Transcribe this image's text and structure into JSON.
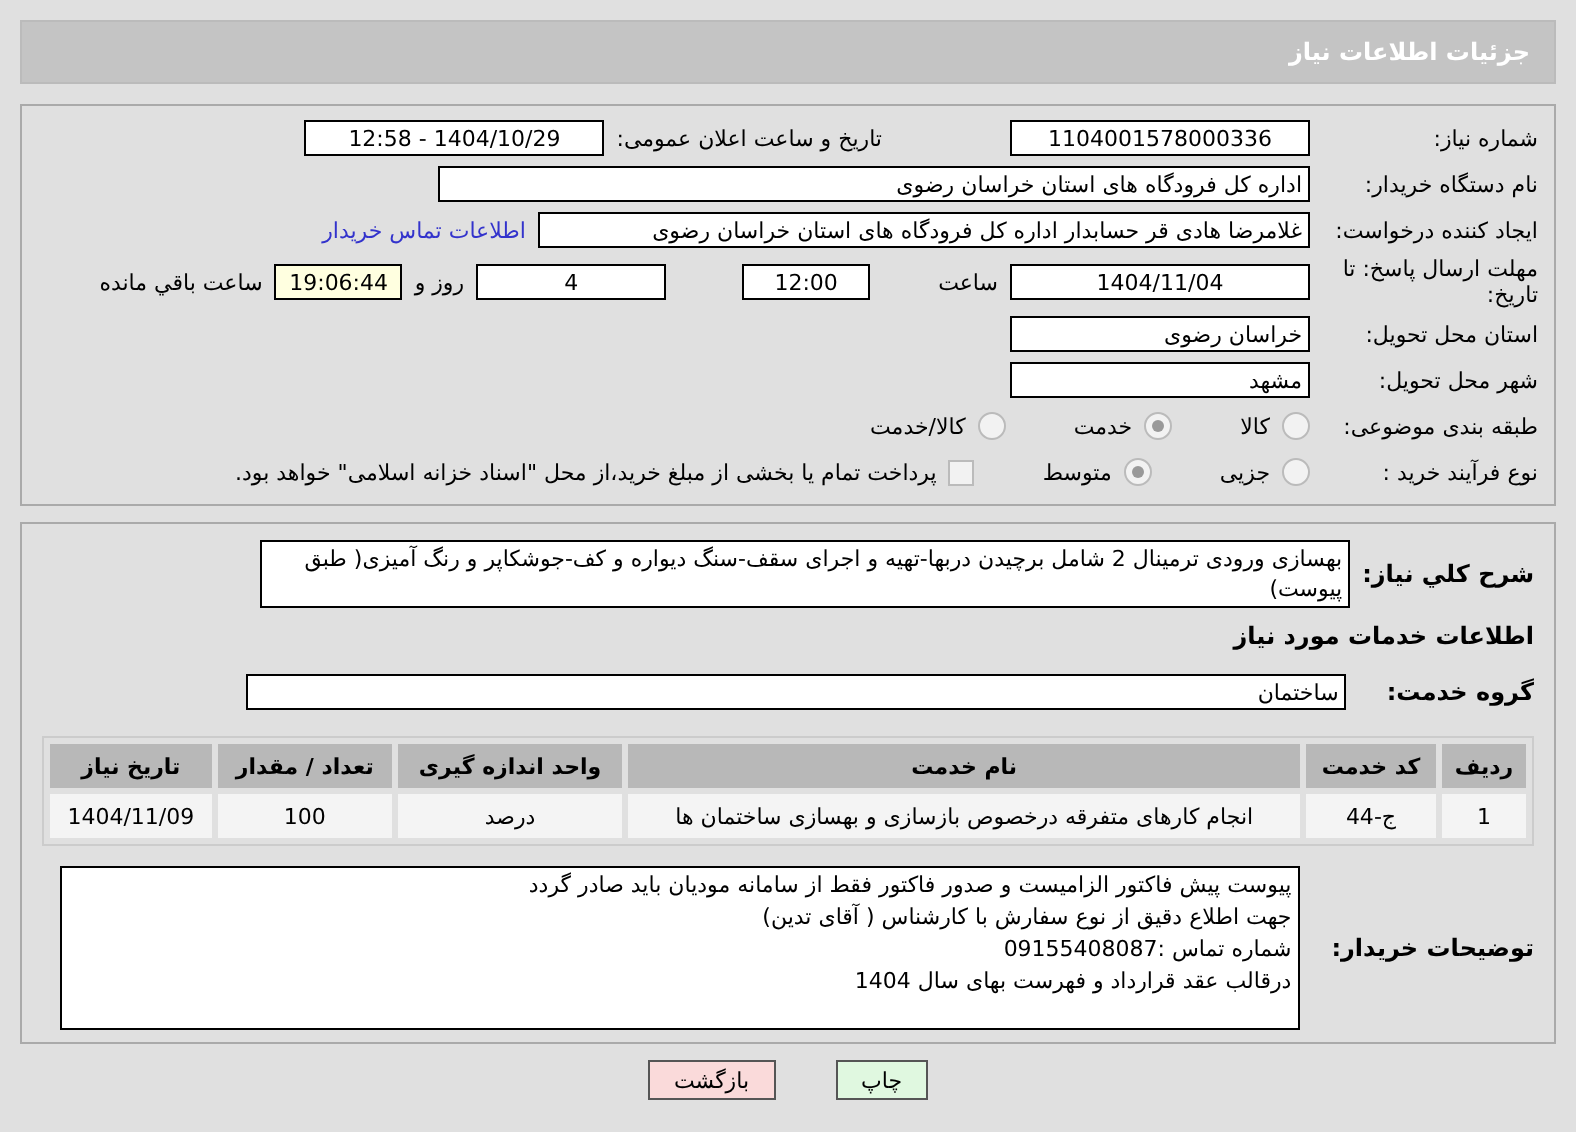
{
  "header": {
    "title": "جزئیات اطلاعات نیاز"
  },
  "need_number": {
    "label": "شماره نیاز:",
    "value": "1104001578000336"
  },
  "announce": {
    "label": "تاریخ و ساعت اعلان عمومی:",
    "value": "1404/10/29 - 12:58"
  },
  "buyer_org": {
    "label": "نام دستگاه خریدار:",
    "value": "اداره کل فرودگاه های استان خراسان رضوی"
  },
  "requester": {
    "label": "ایجاد کننده درخواست:",
    "value": "غلامرضا هادی قر حسابدار اداره کل فرودگاه های استان خراسان رضوی",
    "link": "اطلاعات تماس خریدار"
  },
  "deadline": {
    "label": "مهلت ارسال پاسخ: تا تاریخ:",
    "date": "1404/11/04",
    "time_label": "ساعت",
    "time": "12:00",
    "days": "4",
    "days_label": "روز و",
    "remaining": "19:06:44",
    "remaining_label": "ساعت باقي مانده"
  },
  "province": {
    "label": "استان محل تحویل:",
    "value": "خراسان رضوی"
  },
  "city": {
    "label": "شهر محل تحویل:",
    "value": "مشهد"
  },
  "category": {
    "label": "طبقه بندی موضوعی:",
    "options": [
      {
        "label": "کالا",
        "selected": false
      },
      {
        "label": "خدمت",
        "selected": true
      },
      {
        "label": "کالا/خدمت",
        "selected": false
      }
    ]
  },
  "purchase_type": {
    "label": "نوع فرآیند خرید :",
    "options": [
      {
        "label": "جزیی",
        "selected": false
      },
      {
        "label": "متوسط",
        "selected": true
      }
    ],
    "payment": {
      "label": "پرداخت تمام یا بخشی از مبلغ خرید،از محل \"اسناد خزانه اسلامی\" خواهد بود.",
      "checked": false
    }
  },
  "description": {
    "label": "شرح کلي نياز:",
    "value": "بهسازی  ورودی ترمینال 2 شامل برچیدن دربها-تهیه و اجرای سقف-سنگ دیواره و کف-جوشکاپر و رنگ آمیزی( طبق پیوست)"
  },
  "services_heading": "اطلاعات خدمات مورد نياز",
  "service_group": {
    "label": "گروه خدمت:",
    "value": "ساختمان"
  },
  "table": {
    "columns": [
      "ردیف",
      "کد خدمت",
      "نام خدمت",
      "واحد اندازه گیری",
      "تعداد / مقدار",
      "تاریخ نیاز"
    ],
    "rows": [
      [
        "1",
        "ج-44",
        "انجام کارهای متفرقه درخصوص بازسازی و بهسازی ساختمان ها",
        "درصد",
        "100",
        "1404/11/09"
      ]
    ]
  },
  "buyer_notes": {
    "label": "توضیحات خریدار:",
    "lines": [
      "پیوست پیش فاکتور الزامیست و صدور فاکتور فقط از سامانه مودیان باید صادر گردد",
      "جهت اطلاع دقیق از نوع سفارش با کارشناس   ( آقای تدین)",
      "شماره تماس :09155408087",
      "درقالب عقد قرارداد و فهرست بهای سال 1404"
    ]
  },
  "buttons": [
    {
      "label": "چاپ",
      "kind": "print"
    },
    {
      "label": "بازگشت",
      "kind": "back"
    }
  ]
}
